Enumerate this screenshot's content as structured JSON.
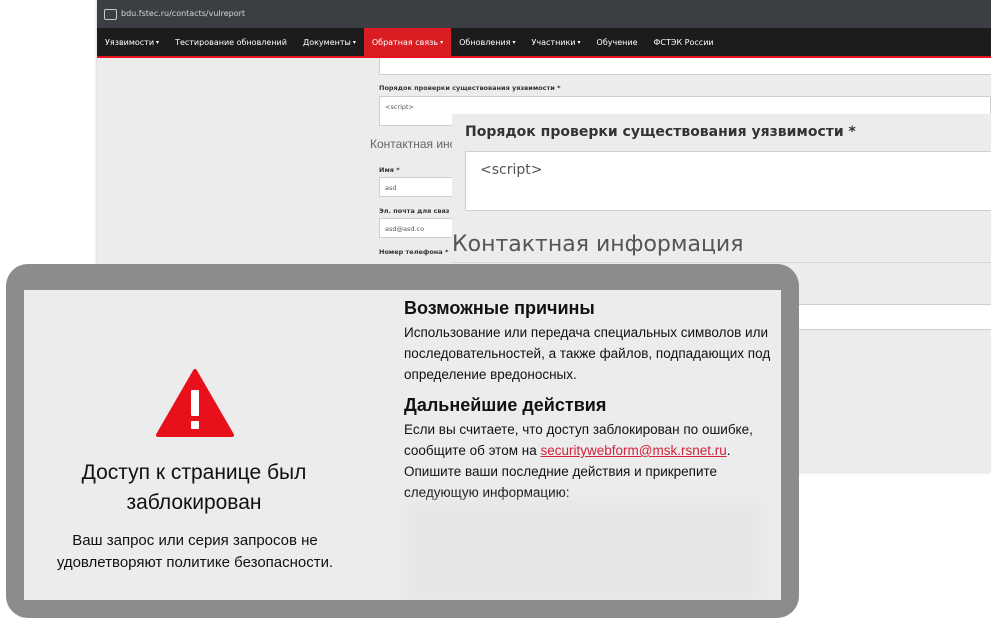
{
  "browser": {
    "url": "bdu.fstec.ru/contacts/vulreport"
  },
  "nav": {
    "items": [
      {
        "label": "Уязвимости",
        "caret": "▾",
        "active": false
      },
      {
        "label": "Тестирование обновлений",
        "caret": "",
        "active": false
      },
      {
        "label": "Документы",
        "caret": "▾",
        "active": false
      },
      {
        "label": "Обратная связь",
        "caret": "▾",
        "active": true
      },
      {
        "label": "Обновления",
        "caret": "▾",
        "active": false
      },
      {
        "label": "Участники",
        "caret": "▾",
        "active": false
      },
      {
        "label": "Обучение",
        "caret": "",
        "active": false
      },
      {
        "label": "ФСТЭК России",
        "caret": "",
        "active": false
      }
    ],
    "active_color": "#d91d22",
    "accent_line": "#e2161c"
  },
  "form": {
    "check_label": "Порядок проверки существования уязвимости *",
    "check_value": "<script>",
    "contact_section": "Контактная информация",
    "contact_section_cut": "Контактная инс",
    "name_label": "Имя *",
    "name_value": "asd",
    "email_label": "Эл. почта для связ",
    "email_value": "asd@asd.co",
    "phone_label": "Номер телефона *"
  },
  "zoom": {
    "label": "Порядок проверки существования уязвимости *",
    "value": "<script>",
    "section": "Контактная информация"
  },
  "block_page": {
    "icon": "warning-triangle-icon",
    "icon_color": "#e8101a",
    "title": "Доступ к странице был заблокирован",
    "subtitle": "Ваш запрос или серия запросов не удовлетворяют политике безопасности.",
    "reasons_heading": "Возможные причины",
    "reasons_text": "Использование или передача специальных символов или последовательностей, а также файлов, подпадающих под определение вредоносных.",
    "actions_heading": "Дальнейшие действия",
    "actions_text_before": "Если вы считаете, что доступ заблокирован по ошибке, сообщите об этом на",
    "actions_email": "securitywebform@msk.rsnet.ru",
    "actions_text_after": ". Опишите ваши последние действия и прикрепите следующую информацию:",
    "link_color": "#d2233c"
  }
}
